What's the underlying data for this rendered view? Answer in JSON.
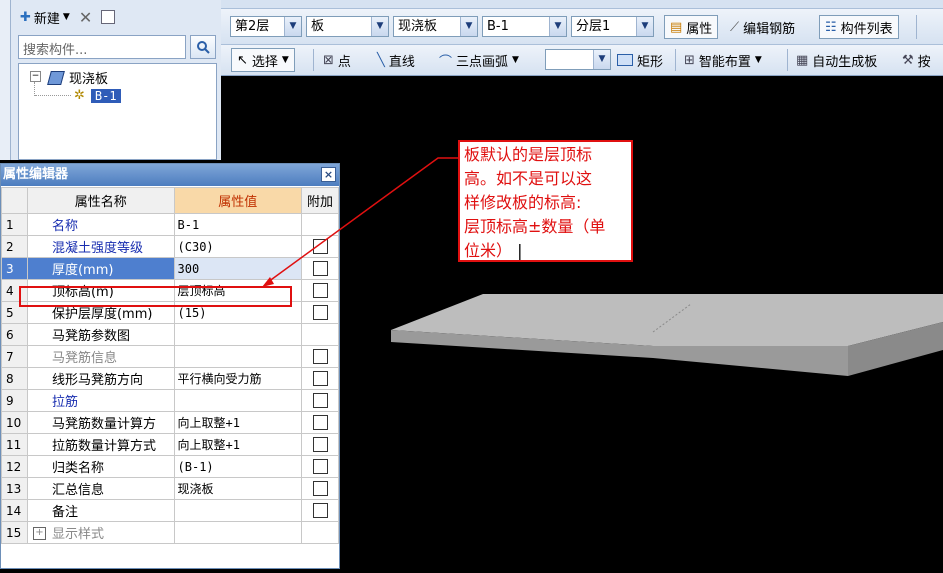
{
  "left_panel": {
    "new_button": "新建",
    "search_placeholder": "搜索构件...",
    "tree": {
      "root_label": "现浇板",
      "child_label": "B-1"
    }
  },
  "toolbar1": {
    "floor": "第2层",
    "category": "板",
    "type": "现浇板",
    "element": "B-1",
    "layer": "分层1",
    "properties_button": "属性",
    "edit_rebar_button": "编辑钢筋",
    "component_list_button": "构件列表"
  },
  "toolbar2": {
    "select": "选择",
    "point": "点",
    "line": "直线",
    "arc": "三点画弧",
    "rect": "矩形",
    "smart_layout": "智能布置",
    "auto_generate": "自动生成板",
    "more": "按"
  },
  "prop_editor": {
    "title": "属性编辑器",
    "close": "×",
    "headers": {
      "name": "属性名称",
      "value": "属性值",
      "add": "附加"
    },
    "rows": [
      {
        "num": "1",
        "name": "名称",
        "value": "B-1",
        "style": "blue",
        "check": false
      },
      {
        "num": "2",
        "name": "混凝土强度等级",
        "value": "(C30)",
        "style": "blue",
        "check": true
      },
      {
        "num": "3",
        "name": "厚度(mm)",
        "value": "300",
        "style": "sel",
        "check": true
      },
      {
        "num": "4",
        "name": "顶标高(m)",
        "value": "层顶标高",
        "style": "",
        "check": true
      },
      {
        "num": "5",
        "name": "保护层厚度(mm)",
        "value": "(15)",
        "style": "",
        "check": true
      },
      {
        "num": "6",
        "name": "马凳筋参数图",
        "value": "",
        "style": "",
        "check": false
      },
      {
        "num": "7",
        "name": "马凳筋信息",
        "value": "",
        "style": "gray",
        "check": true
      },
      {
        "num": "8",
        "name": "线形马凳筋方向",
        "value": "平行横向受力筋",
        "style": "",
        "check": true
      },
      {
        "num": "9",
        "name": "拉筋",
        "value": "",
        "style": "blue",
        "check": true
      },
      {
        "num": "10",
        "name": "马凳筋数量计算方",
        "value": "向上取整+1",
        "style": "",
        "check": true
      },
      {
        "num": "11",
        "name": "拉筋数量计算方式",
        "value": "向上取整+1",
        "style": "",
        "check": true
      },
      {
        "num": "12",
        "name": "归类名称",
        "value": "(B-1)",
        "style": "",
        "check": true
      },
      {
        "num": "13",
        "name": "汇总信息",
        "value": "现浇板",
        "style": "",
        "check": true
      },
      {
        "num": "14",
        "name": "备注",
        "value": "",
        "style": "",
        "check": true
      },
      {
        "num": "15",
        "name": "显示样式",
        "value": "",
        "style": "gray",
        "check": false
      }
    ]
  },
  "annotation": {
    "lines": [
      "板默认的是层顶标",
      "高。如不是可以这",
      "样修改板的标高:",
      "层顶标高±数量（单",
      "位米）"
    ]
  },
  "colors": {
    "accent_red": "#e01010",
    "canvas": "#000000",
    "slab": "#b9b9b9"
  }
}
